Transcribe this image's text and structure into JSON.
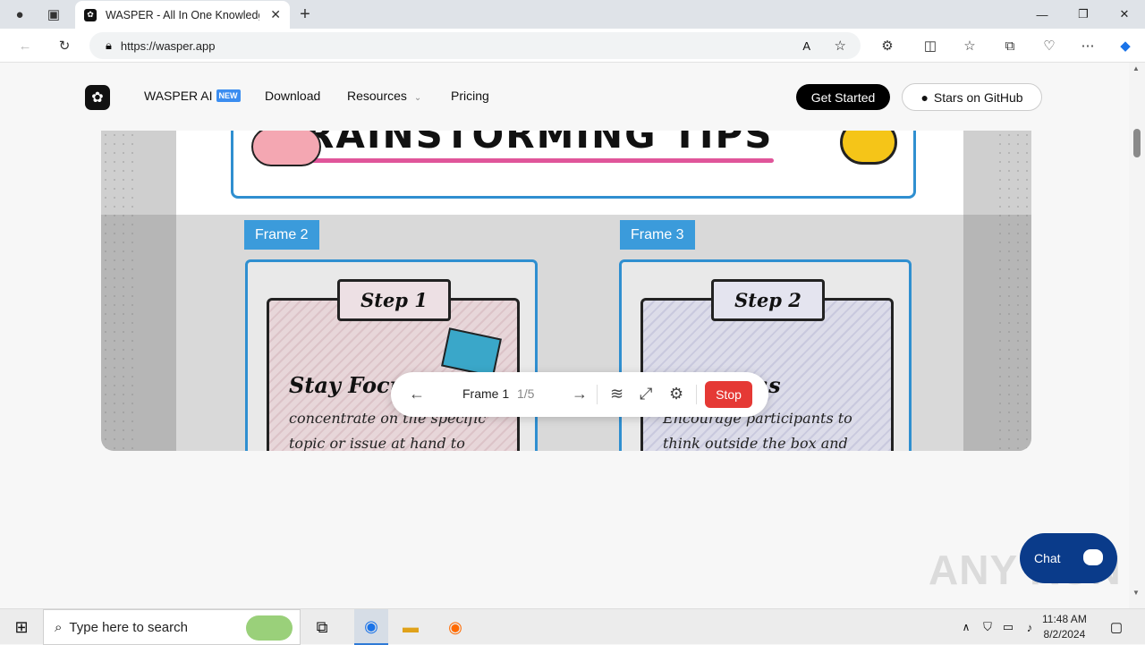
{
  "browser": {
    "tab_title": "WASPER - All In One Knowledge",
    "url": "https://wasper.app"
  },
  "nav": {
    "brand": "WASPER AI",
    "badge": "NEW",
    "links": [
      "Download",
      "Resources",
      "Pricing"
    ],
    "get_started": "Get Started",
    "github": "Stars on GitHub"
  },
  "board": {
    "heading": "BRAINSTORMING TIPS",
    "frames": [
      {
        "label": "Frame 2",
        "step": "Step 1",
        "title": "Stay Focu",
        "text": "concentrate on the specific topic or issue at hand to"
      },
      {
        "label": "Frame 3",
        "step": "Step 2",
        "title": "...ld Ideas",
        "text": "Encourage participants to think outside the box and"
      }
    ]
  },
  "controls": {
    "frame_label": "Frame 1",
    "frame_count": "1/5",
    "stop": "Stop"
  },
  "chat": {
    "label": "Chat"
  },
  "watermark": "ANY RUN",
  "taskbar": {
    "search_placeholder": "Type here to search",
    "time": "11:48 AM",
    "date": "8/2/2024"
  },
  "colors": {
    "accent": "#3b9bdb",
    "stop": "#e53935",
    "chat": "#0a3b8a"
  }
}
